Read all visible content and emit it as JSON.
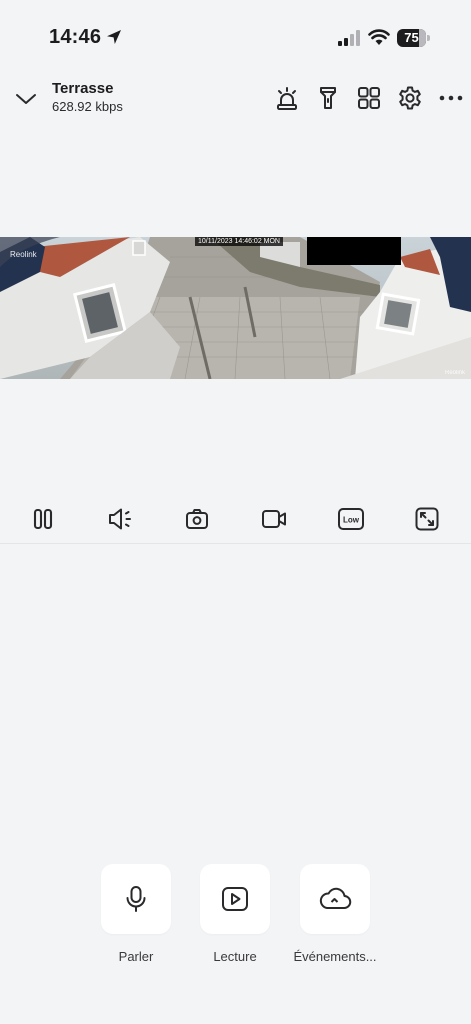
{
  "status_bar": {
    "time": "14:46",
    "battery": "75",
    "battery_level": 0.75,
    "icons": [
      "location-arrow-icon",
      "cellular-signal-icon",
      "wifi-icon",
      "battery-icon"
    ]
  },
  "header": {
    "title": "Terrasse",
    "bitrate": "628.92 kbps",
    "icons": [
      "chevron-down-icon",
      "siren-icon",
      "flashlight-icon",
      "grid-view-icon",
      "gear-icon",
      "more-icon"
    ]
  },
  "video": {
    "timestamp": "10/11/2023 14:46:02 MON",
    "brand_left": "Reolink",
    "brand_right": "Reolink"
  },
  "controls": {
    "items": [
      "pause-icon",
      "speaker-icon",
      "snapshot-icon",
      "record-video-icon",
      "quality-low-icon",
      "fullscreen-icon"
    ],
    "quality_label": "Low"
  },
  "actions": [
    {
      "label": "Parler",
      "icon": "microphone-icon"
    },
    {
      "label": "Lecture",
      "icon": "play-icon"
    },
    {
      "label": "Événements...",
      "icon": "cloud-icon"
    }
  ],
  "colors": {
    "background": "#f3f4f6",
    "icon": "#2a2a2d",
    "tile": "#ffffff"
  }
}
